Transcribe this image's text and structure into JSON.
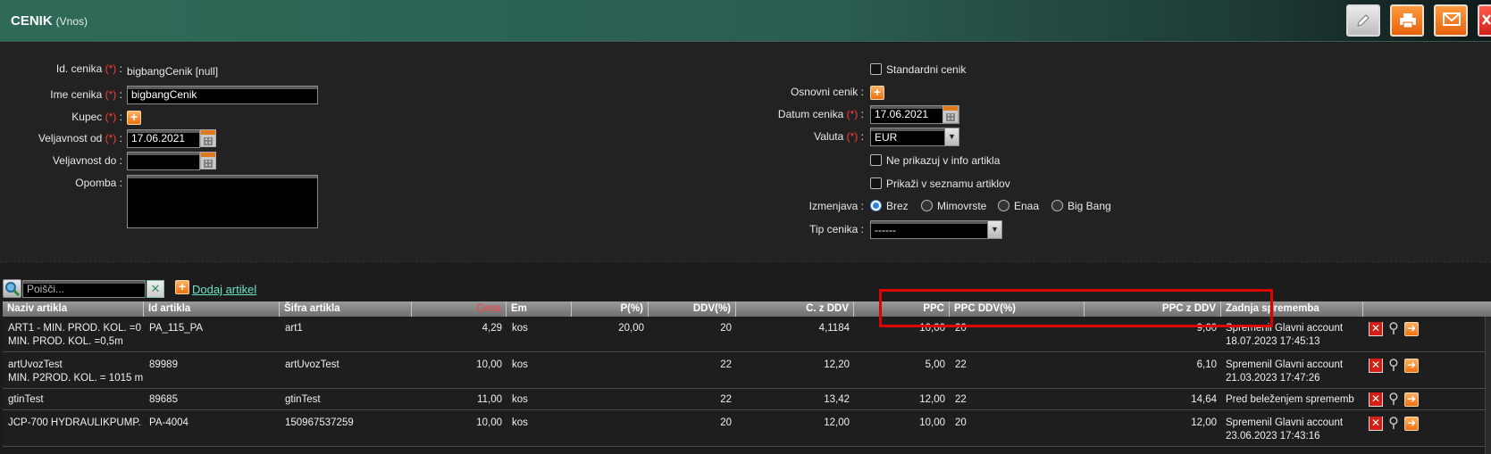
{
  "header": {
    "title": "CENIK",
    "subtitle": "(Vnos)"
  },
  "form": {
    "id_label": "Id. cenika",
    "id_value": "bigbangCenik [null]",
    "ime_label": "Ime cenika",
    "ime_value": "bigbangCenik",
    "kupec_label": "Kupec",
    "veljod_label": "Veljavnost od",
    "veljod_value": "17.06.2021",
    "veljdo_label": "Veljavnost do",
    "veljdo_value": "",
    "opomba_label": "Opomba",
    "req_mark": "(*)",
    "standardni_label": "Standardni cenik",
    "osnovni_label": "Osnovni cenik",
    "datum_label": "Datum cenika",
    "datum_value": "17.06.2021",
    "valuta_label": "Valuta",
    "valuta_value": "EUR",
    "ne_prikazuj_label": "Ne prikazuj v info artikla",
    "prikazi_label": "Prikaži v seznamu artiklov",
    "izmenjava_label": "Izmenjava",
    "izmenjava_options": [
      "Brez",
      "Mimovrste",
      "Enaa",
      "Big Bang"
    ],
    "izmenjava_selected": "Brez",
    "tip_label": "Tip cenika",
    "tip_value": "------",
    "colon": ":"
  },
  "toolbar": {
    "search_placeholder": "Poišči...",
    "add_label": "Dodaj artikel"
  },
  "table": {
    "headers": [
      "Naziv artikla",
      "Id artikla",
      "Šifra artikla",
      "Cena",
      "Em",
      "P(%)",
      "DDV(%)",
      "C. z DDV",
      "PPC",
      "PPC DDV(%)",
      "PPC z DDV",
      "Zadnja sprememba"
    ],
    "rows": [
      {
        "naziv": "ART1 - MIN. PROD. KOL. =0...",
        "naziv2": "MIN. PROD. KOL. =0,5m",
        "id": "PA_115_PA",
        "sifra": "art1",
        "cena": "4,29",
        "em": "kos",
        "p": "20,00",
        "ddv": "20",
        "cddv": "4,1184",
        "ppc": "10,00",
        "ppcddv": "20",
        "ppczddv": "9,60",
        "sprem": "Spremenil Glavni account",
        "sprem2": "18.07.2023 17:45:13"
      },
      {
        "naziv": "artUvozTest",
        "naziv2": "MIN. P2ROD. KOL. = 1015 m",
        "id": "89989",
        "sifra": "artUvozTest",
        "cena": "10,00",
        "em": "kos",
        "p": "",
        "ddv": "22",
        "cddv": "12,20",
        "ppc": "5,00",
        "ppcddv": "22",
        "ppczddv": "6,10",
        "sprem": "Spremenil Glavni account",
        "sprem2": "21.03.2023 17:47:26"
      },
      {
        "naziv": "gtinTest",
        "naziv2": "",
        "id": "89685",
        "sifra": "gtinTest",
        "cena": "11,00",
        "em": "kos",
        "p": "",
        "ddv": "22",
        "cddv": "13,42",
        "ppc": "12,00",
        "ppcddv": "22",
        "ppczddv": "14,64",
        "sprem": "Pred beleženjem sprememb",
        "sprem2": ""
      },
      {
        "naziv": "JCP-700 HYDRAULIKPUMP...",
        "naziv2": "",
        "id": "PA-4004",
        "sifra": "150967537259",
        "cena": "10,00",
        "em": "kos",
        "p": "",
        "ddv": "20",
        "cddv": "12,00",
        "ppc": "10,00",
        "ppcddv": "20",
        "ppczddv": "12,00",
        "sprem": "Spremenil Glavni account",
        "sprem2": "23.06.2023 17:43:16"
      }
    ]
  },
  "colors": {
    "accent": "#2f6a58",
    "required": "#ff3b3b",
    "link": "#6ee3c4",
    "highlight": "#e00000"
  },
  "icons": [
    "pencil-icon",
    "printer-icon",
    "envelope-icon",
    "close-icon",
    "plus-icon",
    "calendar-icon",
    "search-icon",
    "clear-icon",
    "delete-icon",
    "paperclip-icon",
    "arrow-right-icon"
  ]
}
